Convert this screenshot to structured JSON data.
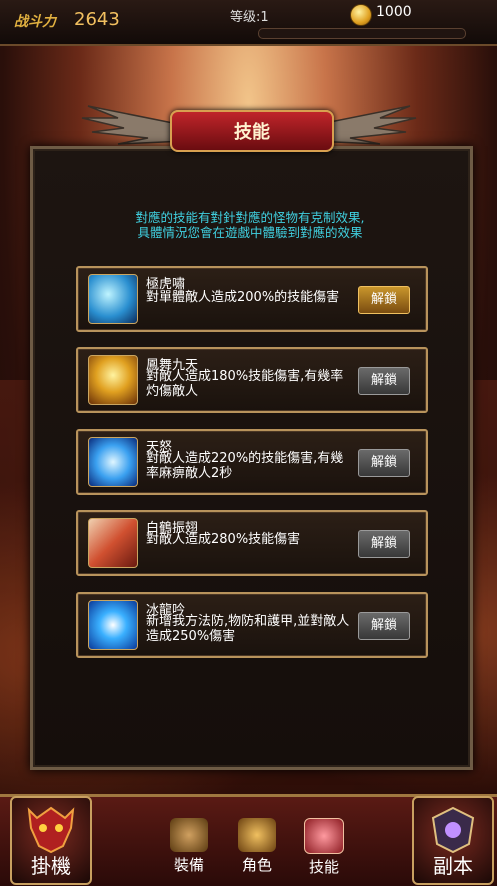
{
  "topbar": {
    "power_label": "战斗力",
    "power_value": "2643",
    "level_text": "等级:1",
    "gold": "1000",
    "xp_progress": 0
  },
  "panel": {
    "title": "技能",
    "intro_line1": "對應的技能有對針對應的怪物有克制效果,",
    "intro_line2": "具體情況您會在遊戲中體驗到對應的效果"
  },
  "skills": [
    {
      "name": "極虎嘯",
      "desc": "對單體敵人造成200%的技能傷害",
      "button": "解鎖",
      "icon": "tiger-roar-icon"
    },
    {
      "name": "鳳舞九天",
      "desc": "對敵人造成180%技能傷害,有幾率灼傷敵人",
      "button": "解鎖",
      "icon": "phoenix-dance-icon"
    },
    {
      "name": "天怒",
      "desc": "對敵人造成220%的技能傷害,有幾率麻痹敵人2秒",
      "button": "解鎖",
      "icon": "heaven-wrath-icon"
    },
    {
      "name": "白鶴振翅",
      "desc": "對敵人造成280%技能傷害",
      "button": "解鎖",
      "icon": "crane-wing-icon"
    },
    {
      "name": "冰龍吟",
      "desc": "新增我方法防,物防和護甲,並對敵人造成250%傷害",
      "button": "解鎖",
      "icon": "ice-dragon-icon"
    }
  ],
  "nav": {
    "idle": "掛機",
    "equip": "裝備",
    "role": "角色",
    "skill": "技能",
    "dungeon": "副本"
  }
}
